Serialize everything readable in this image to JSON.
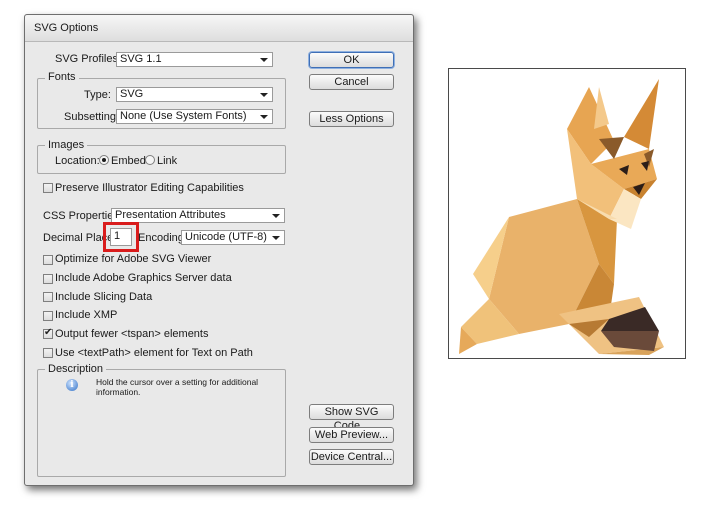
{
  "dialog": {
    "title": "SVG Options",
    "svg_profiles": {
      "label": "SVG Profiles:",
      "value": "SVG 1.1"
    },
    "fonts": {
      "group_label": "Fonts",
      "type_label": "Type:",
      "type_value": "SVG",
      "subsetting_label": "Subsetting:",
      "subsetting_value": "None (Use System Fonts)"
    },
    "images": {
      "group_label": "Images",
      "location_label": "Location:",
      "embed_label": "Embed",
      "embed_selected": true,
      "link_label": "Link"
    },
    "preserve_label": "Preserve Illustrator Editing Capabilities",
    "css_properties": {
      "label": "CSS Properties:",
      "value": "Presentation Attributes"
    },
    "decimal_places": {
      "label": "Decimal Places:",
      "value": "1"
    },
    "encoding": {
      "label": "Encoding:",
      "value": "Unicode (UTF-8)"
    },
    "checkboxes": [
      {
        "label": "Optimize for Adobe SVG Viewer",
        "checked": false
      },
      {
        "label": "Include Adobe Graphics Server data",
        "checked": false
      },
      {
        "label": "Include Slicing Data",
        "checked": false
      },
      {
        "label": "Include XMP",
        "checked": false
      },
      {
        "label": "Output fewer <tspan> elements",
        "checked": true
      },
      {
        "label": "Use <textPath> element for Text on Path",
        "checked": false
      }
    ],
    "description": {
      "group_label": "Description",
      "text_line1": "Hold the cursor over a setting for additional",
      "text_line2": "information.",
      "icon": "info-icon"
    },
    "buttons": {
      "ok": "OK",
      "cancel": "Cancel",
      "less_options": "Less Options",
      "show_svg_code": "Show SVG Code...",
      "web_preview": "Web Preview...",
      "device_central": "Device Central..."
    },
    "colors": {
      "highlight": "#d91c1c",
      "default_button": "#3f6fb6"
    }
  },
  "preview": {
    "subject": "low-poly fox illustration"
  }
}
